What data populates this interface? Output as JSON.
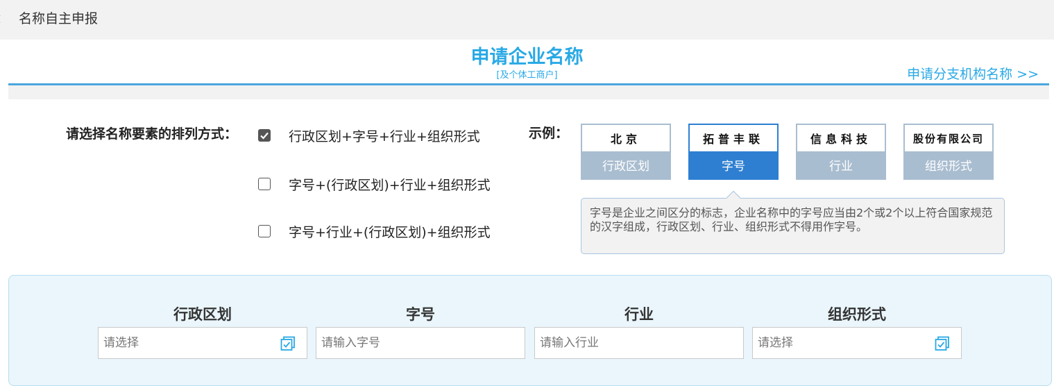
{
  "topbar": {
    "prefix": "：",
    "label": "名称自主申报"
  },
  "header": {
    "title": "申请企业名称",
    "subtitle": "[及个体工商户]",
    "branch_link": "申请分支机构名称 >>"
  },
  "arrangement": {
    "label": "请选择名称要素的排列方式：",
    "options": [
      {
        "text": "行政区划+字号+行业+组织形式",
        "checked": true
      },
      {
        "text": "字号+(行政区划)+行业+组织形式",
        "checked": false
      },
      {
        "text": "字号+行业+(行政区划)+组织形式",
        "checked": false
      }
    ]
  },
  "example": {
    "label": "示例：",
    "cards": [
      {
        "sample": "北京",
        "caption": "行政区划",
        "active": false
      },
      {
        "sample": "拓普丰联",
        "caption": "字号",
        "active": true
      },
      {
        "sample": "信息科技",
        "caption": "行业",
        "active": false
      },
      {
        "sample": "股份有限公司",
        "caption": "组织形式",
        "active": false
      }
    ],
    "tooltip": "字号是企业之间区分的标志，企业名称中的字号应当由2个或2个以上符合国家规范的汉字组成，行政区划、行业、组织形式不得用作字号。"
  },
  "fields": [
    {
      "title": "行政区划",
      "placeholder": "请选择",
      "value": "",
      "icon": "picker-icon"
    },
    {
      "title": "字号",
      "placeholder": "请输入字号",
      "value": ""
    },
    {
      "title": "行业",
      "placeholder": "请输入行业",
      "value": ""
    },
    {
      "title": "组织形式",
      "placeholder": "请选择",
      "value": "",
      "icon": "picker-icon"
    }
  ],
  "colors": {
    "accent": "#29a9e6",
    "active_card": "#2e7fd1",
    "inactive_card": "#a9bdd0",
    "panel_bg": "#eaf6fc"
  }
}
